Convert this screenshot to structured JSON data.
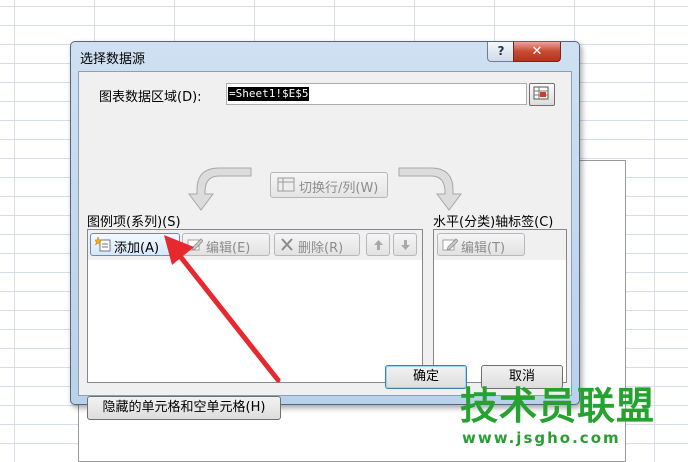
{
  "dialog": {
    "title": "选择数据源",
    "help_label": "?",
    "close_label": "✕",
    "data_range_label": "图表数据区域(D):",
    "data_range_value": "=Sheet1!$E$5",
    "switch_label": "切换行/列(W)"
  },
  "series": {
    "label": "图例项(系列)(S)",
    "add_label": "添加(A)",
    "edit_label": "编辑(E)",
    "delete_label": "删除(R)",
    "items": []
  },
  "axis": {
    "label": "水平(分类)轴标签(C)",
    "edit_label": "编辑(T)",
    "items": []
  },
  "footer": {
    "hidden_cells_label": "隐藏的单元格和空单元格(H)",
    "ok_label": "确定",
    "cancel_label": "取消"
  },
  "watermark": {
    "title": "技术员联盟",
    "url": "www.jsgho.com"
  },
  "colors": {
    "annotation_arrow": "#e8282f",
    "watermark_green": "#25a22f"
  }
}
